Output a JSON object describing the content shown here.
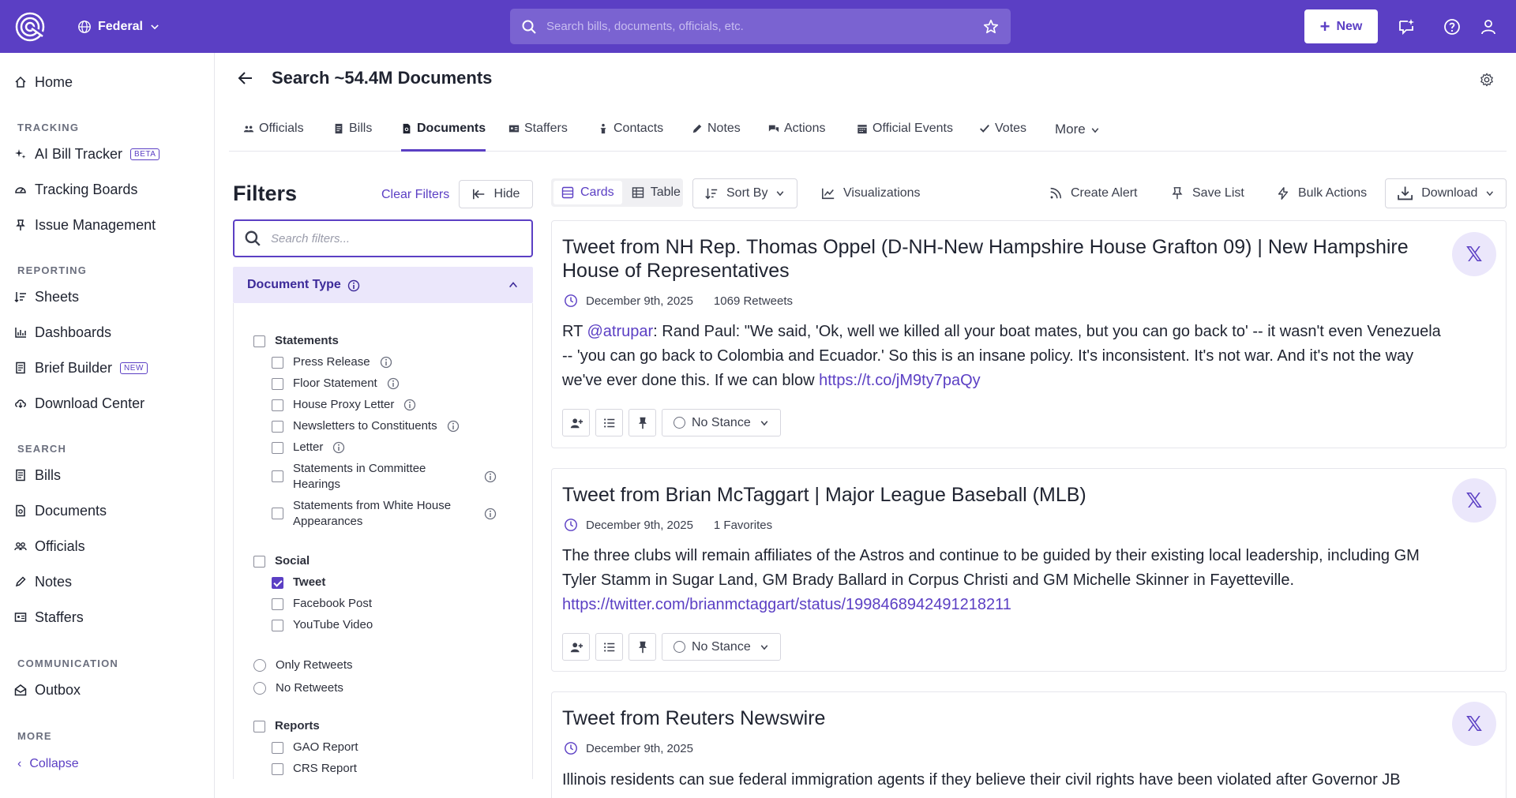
{
  "topbar": {
    "jurisdiction": "Federal",
    "search_placeholder": "Search bills, documents, officials, etc.",
    "new_label": "New"
  },
  "sidebar": {
    "home": "Home",
    "tracking_header": "TRACKING",
    "ai_bill_tracker": "AI Bill Tracker",
    "beta_badge": "BETA",
    "tracking_boards": "Tracking Boards",
    "issue_management": "Issue Management",
    "reporting_header": "REPORTING",
    "sheets": "Sheets",
    "dashboards": "Dashboards",
    "brief_builder": "Brief Builder",
    "new_badge": "NEW",
    "download_center": "Download Center",
    "search_header": "SEARCH",
    "bills": "Bills",
    "documents": "Documents",
    "officials": "Officials",
    "notes": "Notes",
    "staffers": "Staffers",
    "communication_header": "COMMUNICATION",
    "outbox": "Outbox",
    "more_header": "MORE",
    "collapse": "Collapse"
  },
  "page": {
    "title": "Search ~54.4M Documents"
  },
  "tabs": {
    "officials": "Officials",
    "bills": "Bills",
    "documents": "Documents",
    "staffers": "Staffers",
    "contacts": "Contacts",
    "notes": "Notes",
    "actions": "Actions",
    "official_events": "Official Events",
    "votes": "Votes",
    "more": "More"
  },
  "filters": {
    "title": "Filters",
    "clear": "Clear Filters",
    "hide": "Hide",
    "search_placeholder": "Search filters...",
    "doc_type_label": "Document Type",
    "statements": "Statements",
    "press_release": "Press Release",
    "floor_statement": "Floor Statement",
    "house_proxy_letter": "House Proxy Letter",
    "newsletters": "Newsletters to Constituents",
    "letter": "Letter",
    "committee_hearings": "Statements in Committee Hearings",
    "white_house": "Statements from White House Appearances",
    "social": "Social",
    "tweet": "Tweet",
    "facebook_post": "Facebook Post",
    "youtube_video": "YouTube Video",
    "only_retweets": "Only Retweets",
    "no_retweets": "No Retweets",
    "reports": "Reports",
    "gao_report": "GAO Report",
    "crs_report": "CRS Report"
  },
  "toolbar": {
    "cards": "Cards",
    "table": "Table",
    "sort_by": "Sort By",
    "visualizations": "Visualizations",
    "create_alert": "Create Alert",
    "save_list": "Save List",
    "bulk_actions": "Bulk Actions",
    "download": "Download"
  },
  "results": [
    {
      "title": "Tweet from NH Rep. Thomas Oppel (D-NH-New Hampshire House Grafton 09) | New Hampshire House of Representatives",
      "date": "December 9th, 2025",
      "stat": "1069 Retweets",
      "prefix": "RT ",
      "mention": "@atrupar",
      "text": ": Rand Paul: \"We said, 'Ok, well we killed all your boat mates, but you can go back to' -- it wasn't even Venezuela -- 'you can go back to Colombia and Ecuador.' So this is an insane policy. It's inconsistent. It's not war. And it's not the way we've ever done this. If we can blow ",
      "link": "https://t.co/jM9ty7paQy",
      "stance": "No Stance"
    },
    {
      "title": "Tweet from Brian McTaggart | Major League Baseball (MLB)",
      "date": "December 9th, 2025",
      "stat": "1 Favorites",
      "text": "The three clubs will remain affiliates of the Astros and continue to be guided by their existing local leadership, including GM Tyler Stamm in Sugar Land, GM Brady Ballard in Corpus Christi and GM Michelle Skinner in Fayetteville.",
      "link": "https://twitter.com/brianmctaggart/status/1998468942491218211",
      "stance": "No Stance"
    },
    {
      "title": "Tweet from Reuters Newswire",
      "date": "December 9th, 2025",
      "text": "Illinois residents can sue federal immigration agents if they believe their civil rights have been violated after Governor JB"
    }
  ],
  "colors": {
    "brand": "#5b3fc4",
    "brand_light": "#ebe7fb"
  }
}
